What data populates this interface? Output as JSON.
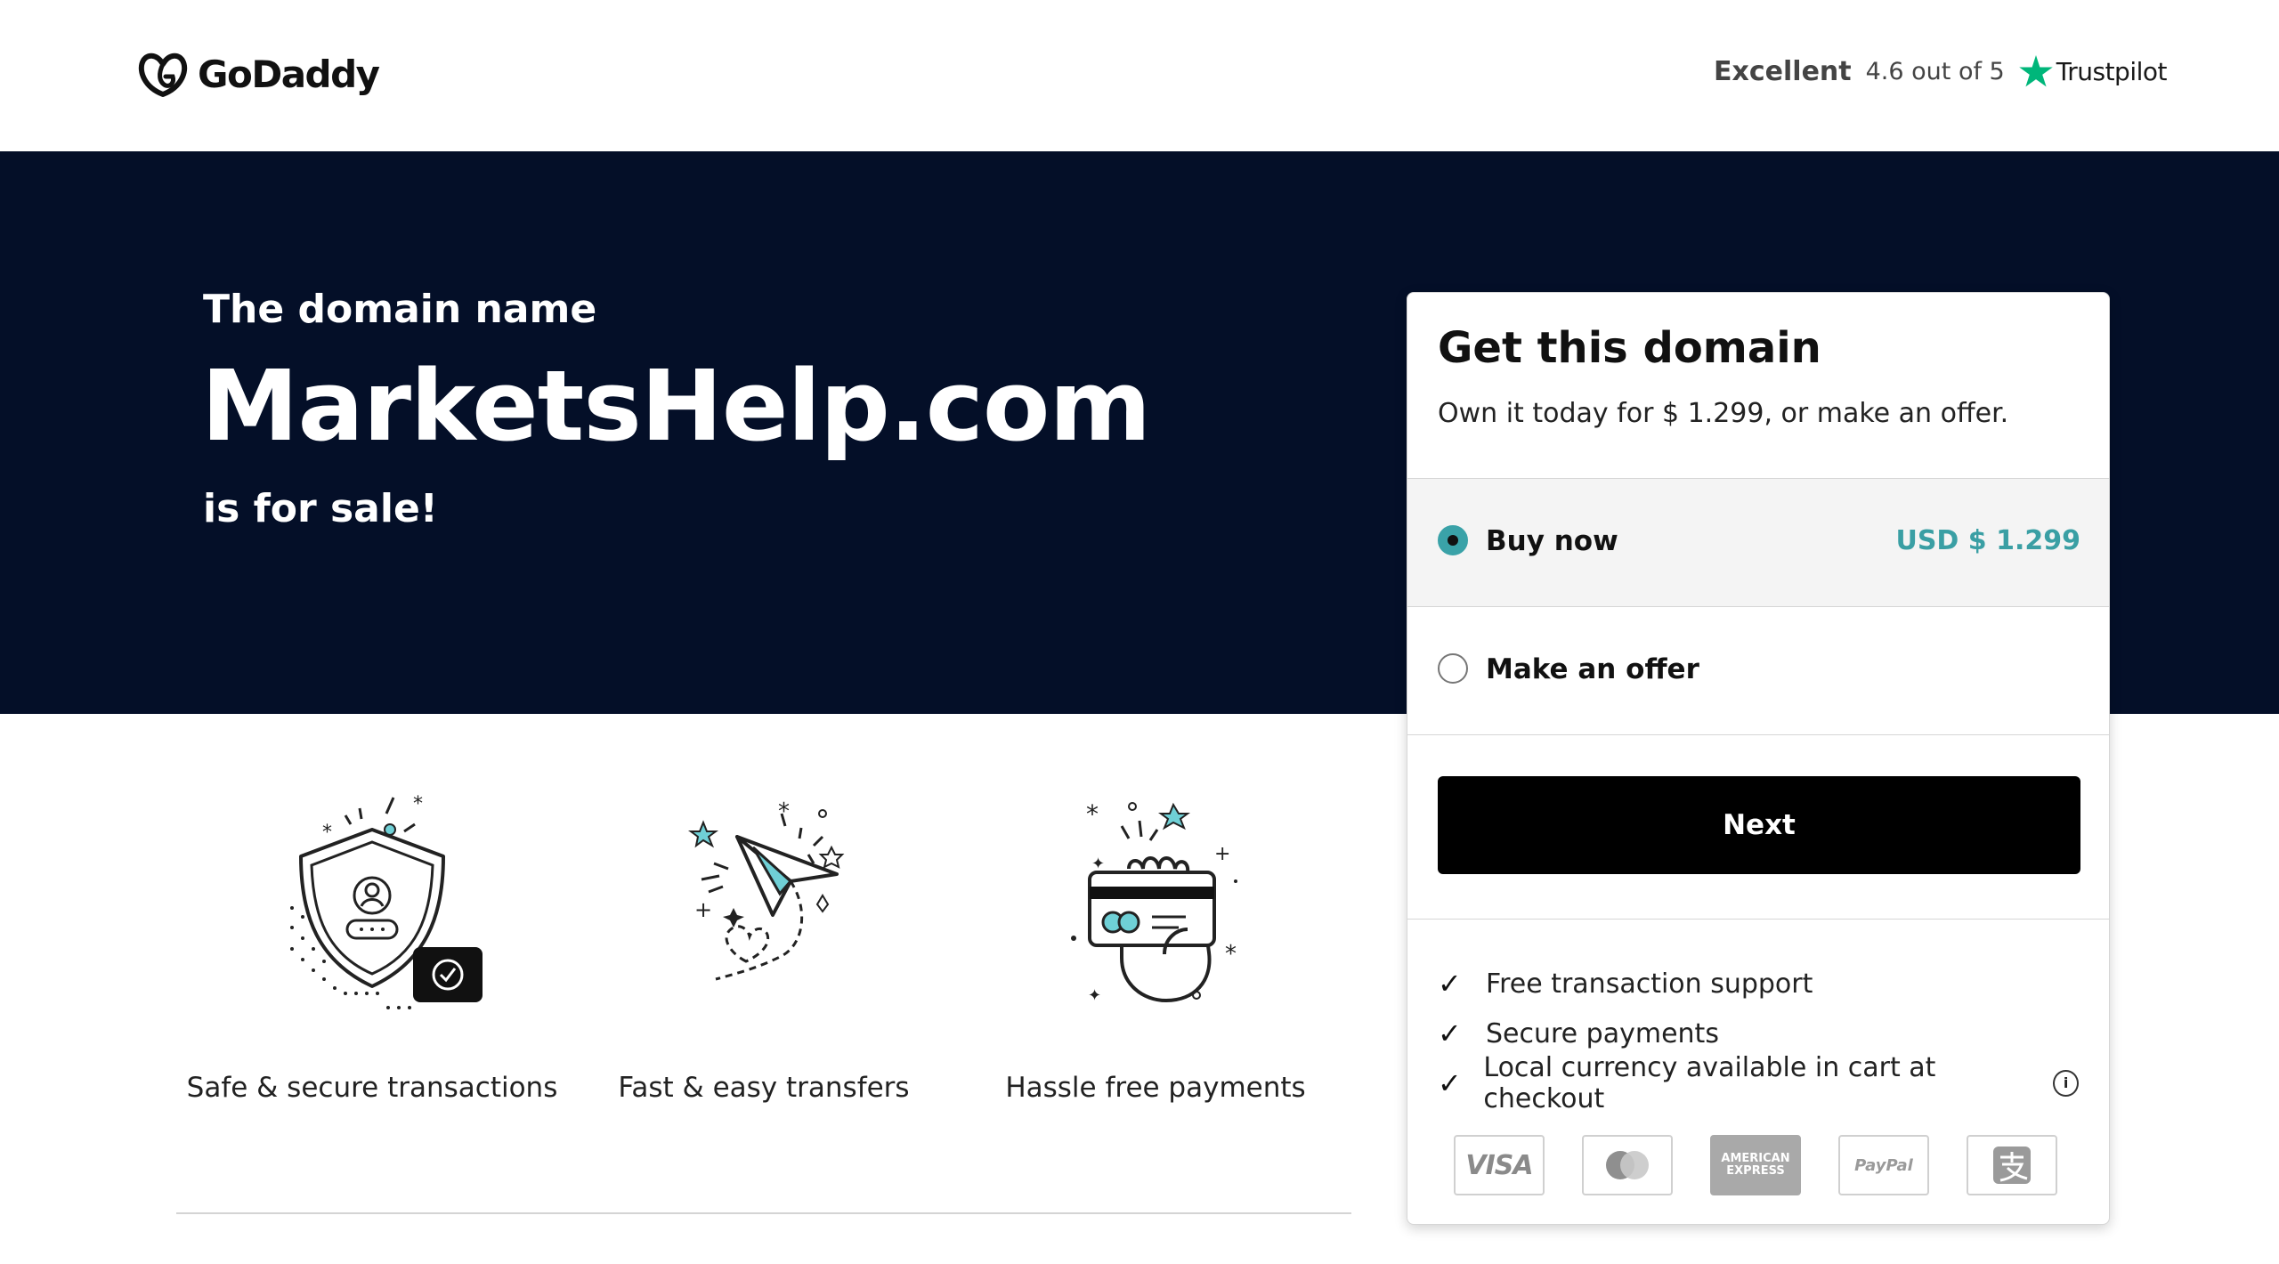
{
  "header": {
    "logo_text": "GoDaddy",
    "trustpilot": {
      "rating_word": "Excellent",
      "score_text": "4.6 out of 5",
      "brand": "Trustpilot"
    }
  },
  "hero": {
    "pre": "The domain name",
    "domain": "MarketsHelp.com",
    "post": "is for sale!"
  },
  "features": [
    {
      "icon": "shield-icon",
      "label": "Safe & secure transactions"
    },
    {
      "icon": "paper-plane-icon",
      "label": "Fast & easy transfers"
    },
    {
      "icon": "credit-card-hand-icon",
      "label": "Hassle free payments"
    }
  ],
  "card": {
    "title": "Get this domain",
    "subtitle": "Own it today for $ 1.299, or make an offer.",
    "options": [
      {
        "label": "Buy now",
        "price": "USD $ 1.299",
        "selected": true
      },
      {
        "label": "Make an offer",
        "price": "",
        "selected": false
      }
    ],
    "next_label": "Next",
    "benefits": [
      "Free transaction support",
      "Secure payments",
      "Local currency available in cart at checkout"
    ],
    "payment_methods": {
      "visa": "VISA",
      "amex": "AMERICAN EXPRESS",
      "paypal": "PayPal",
      "icons": [
        "visa-icon",
        "mastercard-icon",
        "amex-icon",
        "paypal-icon",
        "alipay-icon"
      ]
    }
  },
  "colors": {
    "hero_bg": "#040f28",
    "accent": "#3aa2a8",
    "trustpilot_green": "#00b67a",
    "button": "#000000"
  }
}
